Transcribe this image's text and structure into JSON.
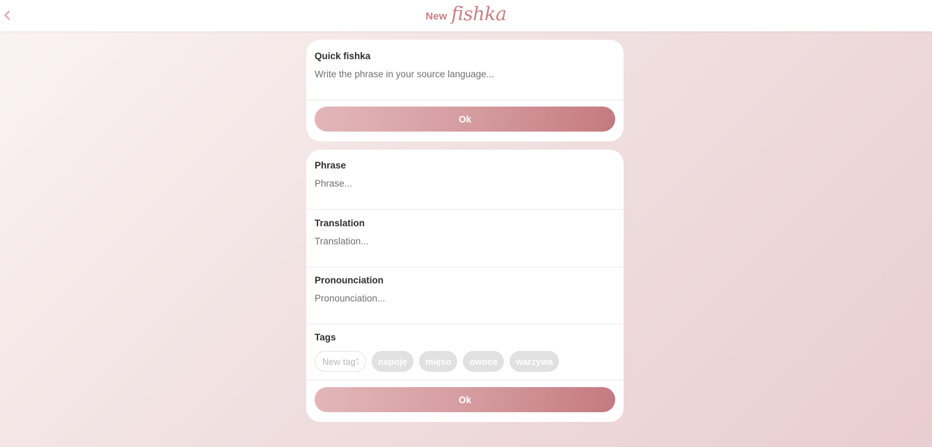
{
  "header": {
    "back_icon": "chevron-left-icon",
    "title_prefix": "New",
    "logo_text": "fishka",
    "accent_color": "#c87f86"
  },
  "quick": {
    "label": "Quick fishka",
    "placeholder": "Write the phrase in your source language...",
    "ok_label": "Ok"
  },
  "form": {
    "phrase": {
      "label": "Phrase",
      "placeholder": "Phrase..."
    },
    "translation": {
      "label": "Translation",
      "placeholder": "Translation..."
    },
    "pronunciation": {
      "label": "Pronounciation",
      "placeholder": "Pronounciation..."
    },
    "tags": {
      "label": "Tags",
      "new_tag_placeholder": "New tag?",
      "items": [
        "napoje",
        "mięso",
        "owoce",
        "warzywa"
      ]
    },
    "ok_label": "Ok"
  }
}
